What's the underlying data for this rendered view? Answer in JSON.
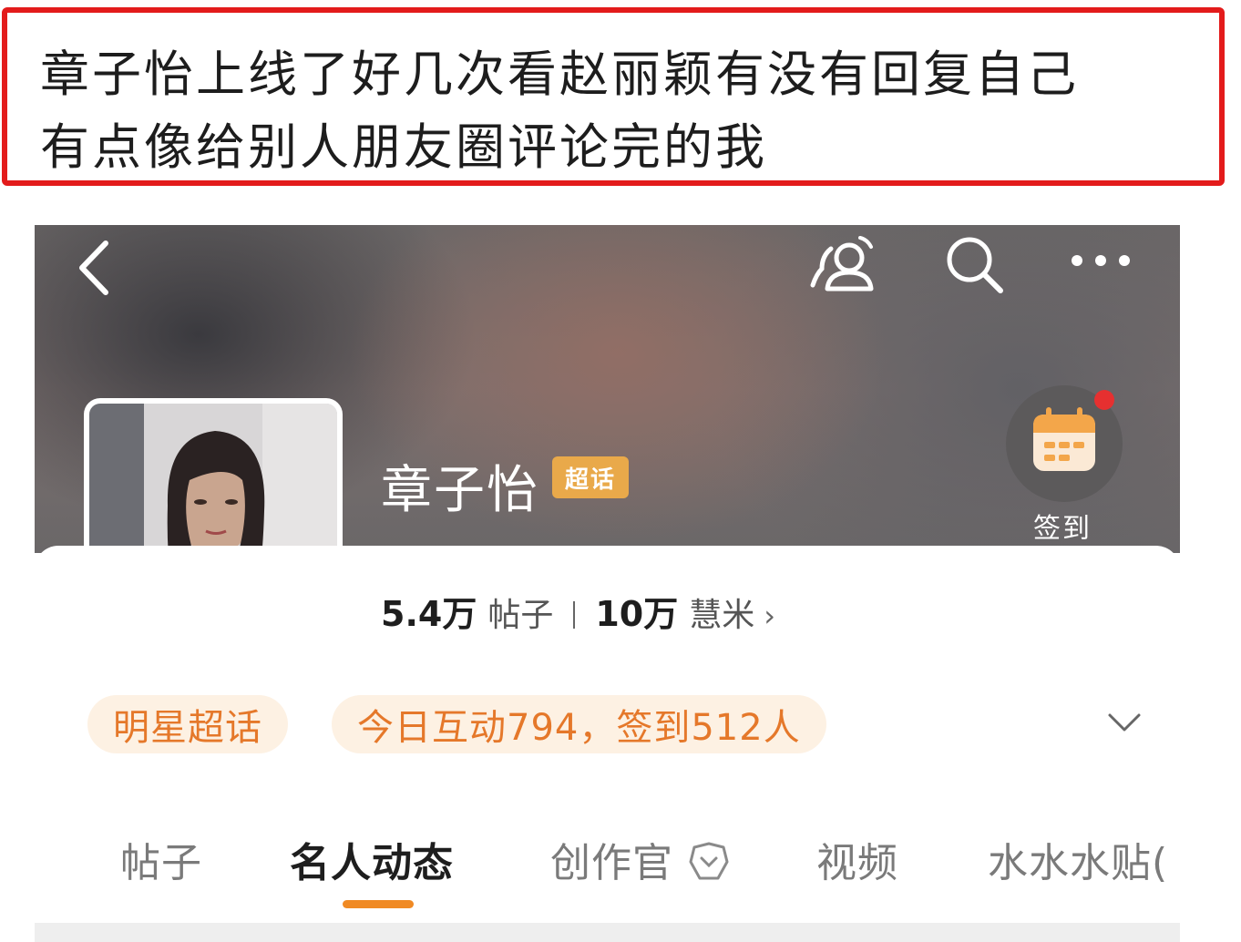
{
  "caption": {
    "line1": "章子怡上线了好几次看赵丽颖有没有回复自己",
    "line2": "有点像给别人朋友圈评论完的我"
  },
  "header": {
    "icons": [
      "back-icon",
      "people-icon",
      "search-icon",
      "more-icon"
    ]
  },
  "profile": {
    "name": "章子怡",
    "badge": "超话",
    "signin_label": "签到",
    "posts_count": "5.4万",
    "posts_label": "帖子",
    "fans_count": "10万",
    "fans_label": "慧米",
    "fans_arrow": "›"
  },
  "tags": {
    "category": "明星超话",
    "activity": "今日互动794，签到512人"
  },
  "tabs": [
    {
      "label": "帖子"
    },
    {
      "label": "名人动态"
    },
    {
      "label": "创作官"
    },
    {
      "label": "视频"
    },
    {
      "label": "水水水贴("
    }
  ],
  "colors": {
    "caption_border": "#e31b1b",
    "accent_orange": "#f08a24",
    "tag_text": "#e5782a",
    "tag_bg": "#fdf1e3",
    "badge_bg": "#e9a94a",
    "notification_dot": "#e63030"
  }
}
